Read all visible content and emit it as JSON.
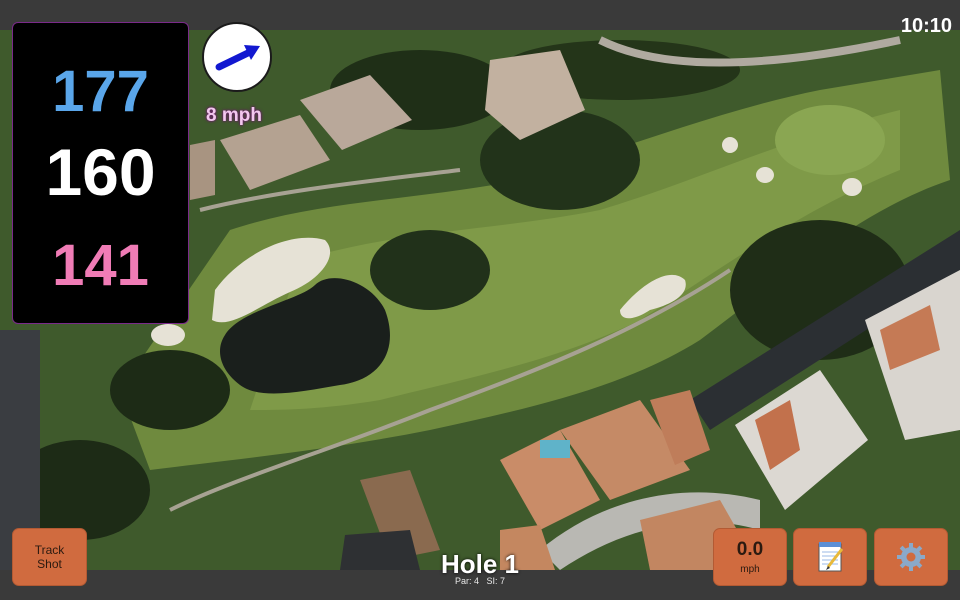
{
  "status": {
    "time": "10:10"
  },
  "distances": {
    "back": "177",
    "center": "160",
    "front": "141"
  },
  "wind": {
    "speed_label": "8 mph",
    "direction_icon": "arrow-right-icon"
  },
  "hole": {
    "title": "Hole 1",
    "par": "Par: 4",
    "stroke_index": "SI: 7"
  },
  "buttons": {
    "track_shot": {
      "line1": "Track",
      "line2": "Shot"
    },
    "speed": {
      "value": "0.0",
      "unit": "mph"
    },
    "notes_icon": "notepad-icon",
    "settings_icon": "gear-icon"
  },
  "colors": {
    "back": "#5aa6ea",
    "center": "#ffffff",
    "front": "#f07cb6",
    "button": "#d06b3f",
    "wind_text": "#f2c8ee"
  }
}
